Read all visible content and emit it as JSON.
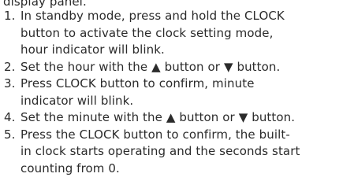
{
  "intro": "display panel.",
  "steps": [
    {
      "number": "1.",
      "lines": [
        "In standby mode, press and hold the CLOCK",
        "button to activate the clock setting mode,",
        "hour indicator will blink."
      ]
    },
    {
      "number": "2.",
      "lines": [
        "Set the hour with the ▲ button or ▼ button."
      ]
    },
    {
      "number": "3.",
      "lines": [
        "Press CLOCK button to confirm, minute",
        "indicator will blink."
      ]
    },
    {
      "number": "4.",
      "lines": [
        "Set the minute with the ▲ button or ▼ button."
      ]
    },
    {
      "number": "5.",
      "lines": [
        "Press the CLOCK button to confirm, the built-",
        "in clock starts operating and the seconds start",
        "counting from 0."
      ]
    }
  ]
}
